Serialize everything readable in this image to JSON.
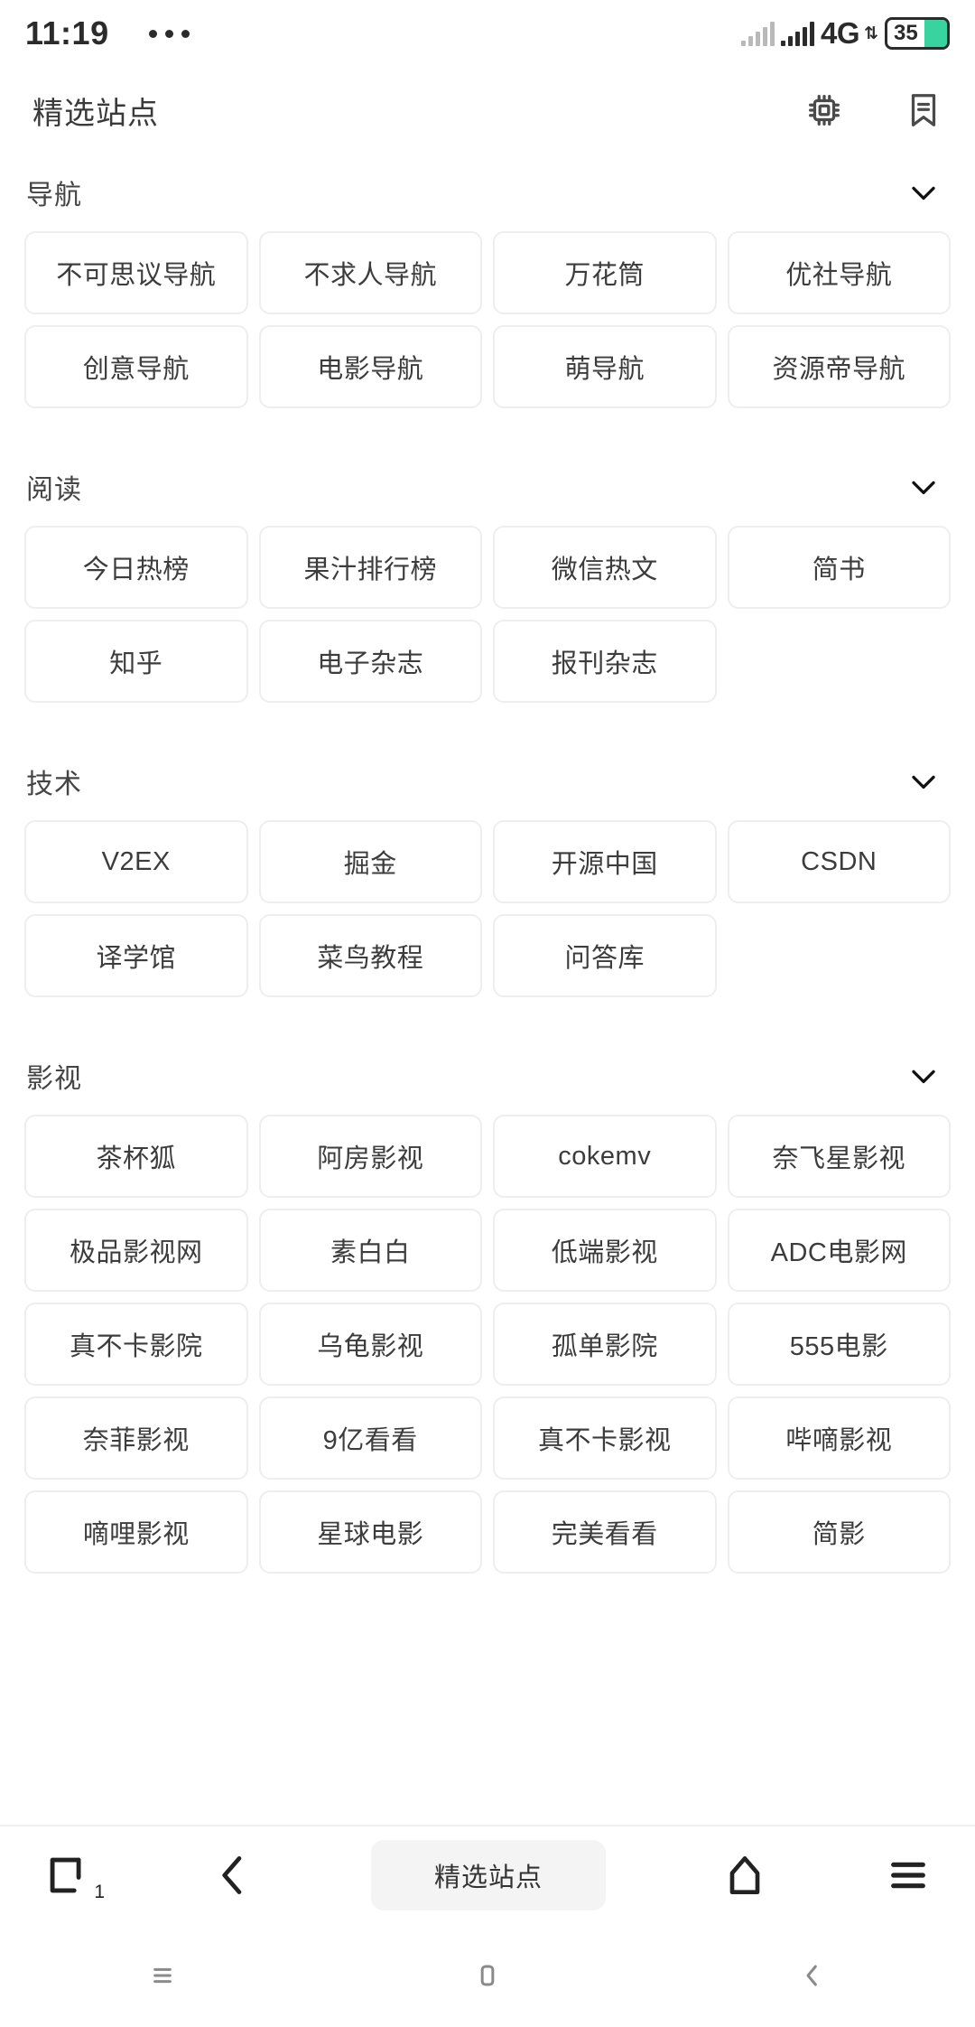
{
  "status_bar": {
    "time": "11:19",
    "network": "4G",
    "battery_level": "35",
    "battery_color": "#38d39f"
  },
  "header": {
    "title": "精选站点",
    "actions": [
      {
        "icon": "chip-icon"
      },
      {
        "icon": "bookmark-icon"
      }
    ]
  },
  "sections": [
    {
      "title": "导航",
      "items": [
        "不可思议导航",
        "不求人导航",
        "万花筒",
        "优社导航",
        "创意导航",
        "电影导航",
        "萌导航",
        "资源帝导航"
      ]
    },
    {
      "title": "阅读",
      "items": [
        "今日热榜",
        "果汁排行榜",
        "微信热文",
        "简书",
        "知乎",
        "电子杂志",
        "报刊杂志"
      ]
    },
    {
      "title": "技术",
      "items": [
        "V2EX",
        "掘金",
        "开源中国",
        "CSDN",
        "译学馆",
        "菜鸟教程",
        "问答库"
      ]
    },
    {
      "title": "影视",
      "items": [
        "茶杯狐",
        "阿房影视",
        "cokemv",
        "奈飞星影视",
        "极品影视网",
        "素白白",
        "低端影视",
        "ADC电影网",
        "真不卡影院",
        "乌龟影视",
        "孤单影院",
        "555电影",
        "奈菲影视",
        "9亿看看",
        "真不卡影视",
        "哔嘀影视",
        "嘀哩影视",
        "星球电影",
        "完美看看",
        "简影"
      ]
    }
  ],
  "toolbar": {
    "tab_count": "1",
    "page_title": "精选站点"
  }
}
